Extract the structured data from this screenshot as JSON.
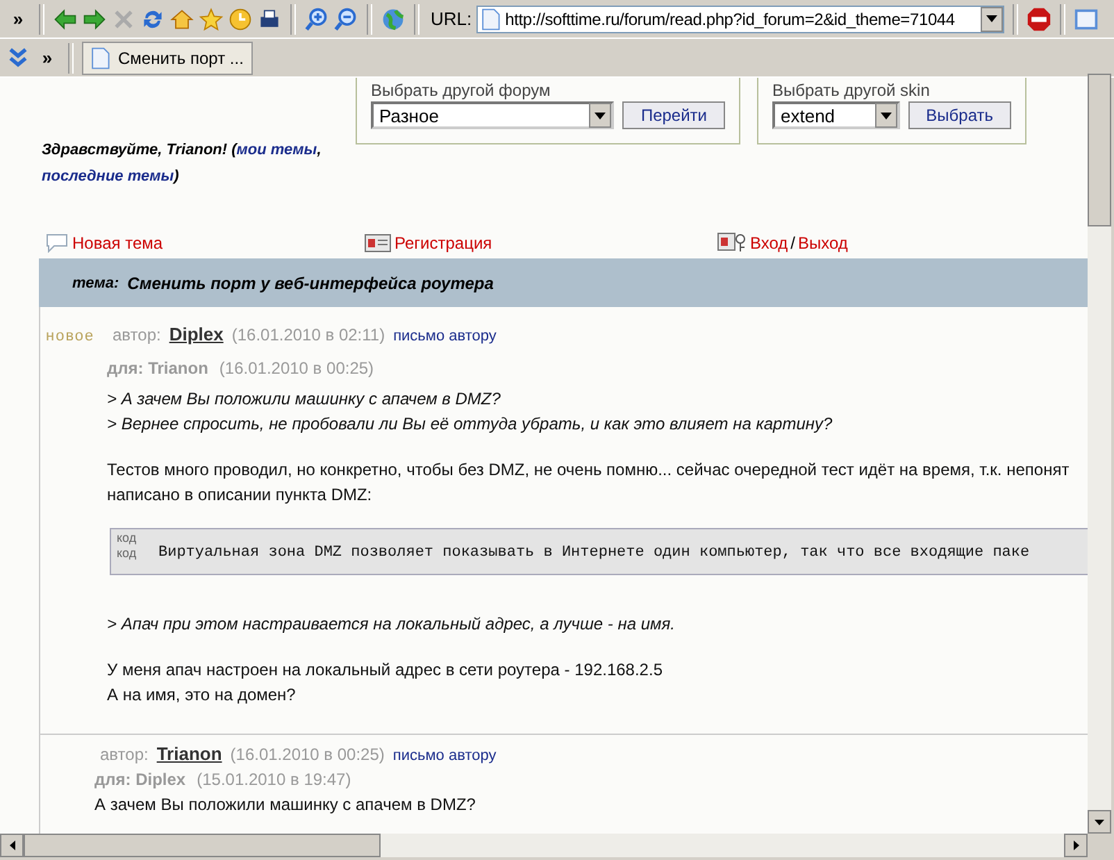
{
  "browser": {
    "url_label": "URL:",
    "url": "http://softtime.ru/forum/read.php?id_forum=2&id_theme=71044",
    "tab_title": "Сменить порт ...",
    "overflow": "»"
  },
  "forum_select": {
    "label": "Выбрать другой форум",
    "value": "Разное",
    "button": "Перейти"
  },
  "skin_select": {
    "label": "Выбрать другой skin",
    "value": "extend",
    "button": "Выбрать"
  },
  "greeting": {
    "prefix": "Здравствуйте, Trianon! (",
    "links": [
      "мои темы",
      "последние темы"
    ],
    "separator": ",",
    "suffix": ")"
  },
  "nav": [
    {
      "kind": "new",
      "links": [
        "Новая тема"
      ]
    },
    {
      "kind": "register",
      "links": [
        "Регистрация"
      ]
    },
    {
      "kind": "login",
      "links": [
        "Вход",
        "Выход"
      ],
      "separator": "/"
    }
  ],
  "topic": {
    "label": "тема:",
    "title": "Сменить порт у веб-интерфейса роутера"
  },
  "posts": [
    {
      "new": true,
      "badge": "новое",
      "author_label": "автор:",
      "author": "Diplex",
      "date": "(16.01.2010 в 02:11)",
      "mail": "письмо автору",
      "to": "для: Trianon",
      "to_date": "(16.01.2010 в 00:25)",
      "body": [
        {
          "kind": "quote",
          "lines": [
            "> А зачем Вы положили машинку с апачем в DMZ?",
            "> Вернее спросить, не пробовали ли Вы её оттуда убрать, и как это влияет на картину?"
          ]
        },
        {
          "kind": "text",
          "lines": [
            "Тестов много проводил, но конкретно, чтобы без DMZ, не очень помню... сейчас очередной тест идёт на время, т.к. непонят",
            "написано в описании пункта DMZ:"
          ]
        },
        {
          "kind": "code",
          "labels": [
            "код",
            "код"
          ],
          "lines": [
            "Виртуальная зона DMZ позволяет показывать в Интернете один компьютер, так что все входящие паке"
          ]
        },
        {
          "kind": "quote",
          "lines": [
            "> Апач при этом настраивается на локальный адрес, а лучше - на имя."
          ]
        },
        {
          "kind": "text",
          "lines": [
            "У меня апач настроен на локальный адрес в сети роутера - 192.168.2.5",
            "А на имя, это на домен?"
          ]
        }
      ]
    },
    {
      "new": false,
      "author_label": "автор:",
      "author": "Trianon",
      "date": "(16.01.2010 в 00:25)",
      "mail": "письмо автору",
      "to": "для: Diplex",
      "to_date": "(15.01.2010 в 19:47)",
      "body": [
        {
          "kind": "text",
          "lines": [
            "А зачем Вы положили машинку с апачем в DMZ?"
          ]
        }
      ]
    }
  ]
}
